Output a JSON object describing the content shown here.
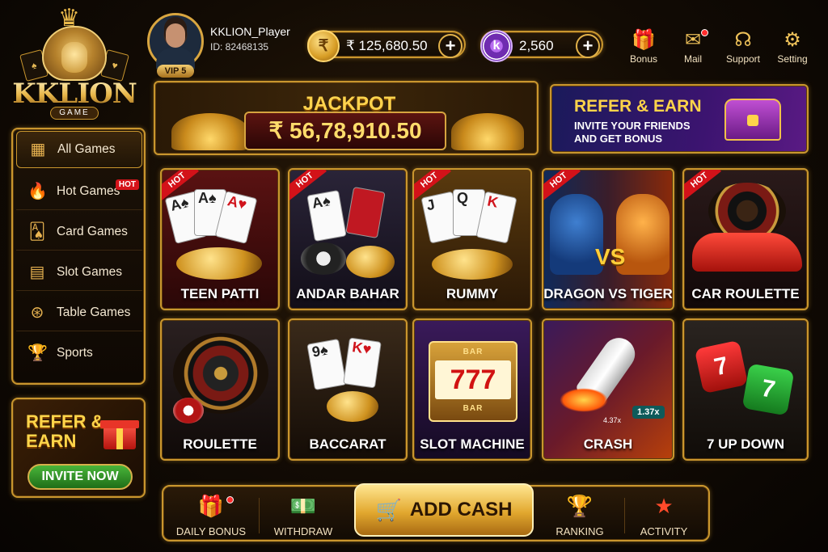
{
  "logo": {
    "name": "KKLION",
    "sub": "GAME"
  },
  "player": {
    "name": "KKLION_Player",
    "id": "ID: 82468135",
    "vip": "VIP 5"
  },
  "balance": {
    "cash": "₹ 125,680.50",
    "cash_icon": "₹",
    "coins": "2,560",
    "coin_icon": "k"
  },
  "header_buttons": [
    {
      "label": "Bonus",
      "icon": "gift-icon"
    },
    {
      "label": "Mail",
      "icon": "mail-icon"
    },
    {
      "label": "Support",
      "icon": "headset-icon"
    },
    {
      "label": "Setting",
      "icon": "gear-icon"
    }
  ],
  "sidebar": {
    "items": [
      {
        "label": "All Games",
        "icon": "grid-icon",
        "active": true
      },
      {
        "label": "Hot Games",
        "icon": "flame-icon",
        "badge": "HOT"
      },
      {
        "label": "Card Games",
        "icon": "cards-icon"
      },
      {
        "label": "Slot Games",
        "icon": "slot-icon"
      },
      {
        "label": "Table Games",
        "icon": "chip-icon"
      },
      {
        "label": "Sports",
        "icon": "trophy-icon"
      }
    ],
    "refer": {
      "title": "REFER & EARN",
      "button": "INVITE NOW"
    }
  },
  "jackpot": {
    "label": "JACKPOT",
    "amount": "₹ 56,78,910.50"
  },
  "refer_banner": {
    "title": "REFER & EARN",
    "subtitle": "INVITE YOUR FRIENDS AND GET BONUS"
  },
  "games": [
    {
      "title": "TEEN PATTI",
      "hot": "HOT"
    },
    {
      "title": "ANDAR BAHAR",
      "hot": "HOT"
    },
    {
      "title": "RUMMY",
      "hot": "HOT"
    },
    {
      "title": "DRAGON VS TIGER",
      "hot": "HOT"
    },
    {
      "title": "CAR ROULETTE",
      "hot": "HOT"
    },
    {
      "title": "ROULETTE"
    },
    {
      "title": "BACCARAT"
    },
    {
      "title": "SLOT MACHINE"
    },
    {
      "title": "CRASH"
    },
    {
      "title": "7 UP DOWN"
    }
  ],
  "tile_text": {
    "vs": "VS",
    "aces": [
      "A",
      "A",
      "A"
    ],
    "rummy": [
      "J",
      "Q",
      "K"
    ],
    "bacc": [
      "9",
      "K"
    ],
    "slot": "777",
    "bar": "BAR",
    "crash": [
      "1.37x",
      "4.37x"
    ],
    "dice": [
      "7",
      "7"
    ]
  },
  "bottom_bar": {
    "daily_bonus": "DAILY BONUS",
    "withdraw": "WITHDRAW",
    "add_cash": "ADD CASH",
    "ranking": "RANKING",
    "activity": "ACTIVITY"
  }
}
